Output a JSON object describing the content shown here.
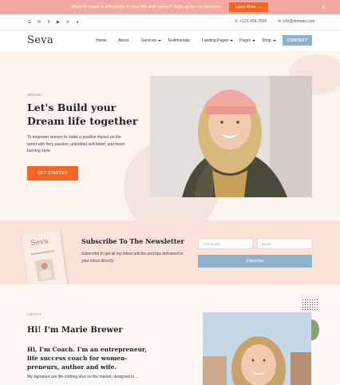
{
  "topbar": {
    "message": "Want to make a difference in your life and career? Sign up for my services.",
    "cta_label": "Learn More",
    "close_icon": "×"
  },
  "social": {
    "icons": [
      "menu-icon",
      "email-icon",
      "facebook-icon",
      "youtube-icon",
      "pinterest-icon",
      "twitter-icon"
    ],
    "phone": "+123-456-7890",
    "email": "info@domain.com"
  },
  "nav": {
    "logo": "Seva",
    "items": {
      "home": "Home",
      "about": "About",
      "services": "Services",
      "testimonials": "Testimonials",
      "landing": "Landing Pages",
      "pages": "Pages",
      "shop": "Shop"
    },
    "contact": "CONTACT"
  },
  "hero": {
    "eyebrow": "Welcome",
    "title": "Let's Build your Dream life together",
    "subtitle": "To empower women to make a positive impact on the world with fiery passion, unbridled self-belief, and heart-burning style.",
    "cta": "GET STARTED"
  },
  "newsletter": {
    "book_title": "Seva",
    "title": "Subscribe To The Newsletter",
    "description": "Subscribe to get all my latest articles and tips delivered to your inbox directly.",
    "first_name_placeholder": "First Name",
    "email_placeholder": "Email",
    "button": "Subscribe"
  },
  "about": {
    "eyebrow": "ABOUT",
    "title": "Hi! I'm Marie Brewer",
    "subtitle": "Hi, I'm Coach. I'm an entrepreneur, life success coach for women-preneurs, author and wife.",
    "description": "My signature are life-nothing else on the market, designed to ..."
  },
  "colors": {
    "accent": "#f26722",
    "blue": "#8fb1cf",
    "topbar": "#f2a9a0"
  }
}
